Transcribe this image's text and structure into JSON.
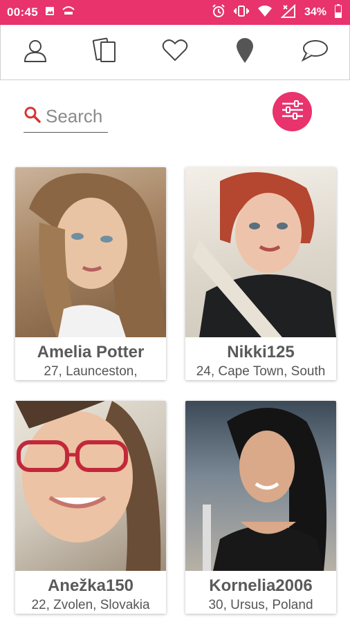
{
  "status_bar": {
    "time": "00:45",
    "battery": "34%",
    "color": "#e8336d"
  },
  "nav": {
    "items": [
      {
        "icon": "profile-icon"
      },
      {
        "icon": "cards-icon"
      },
      {
        "icon": "heart-icon"
      },
      {
        "icon": "location-pin-icon"
      },
      {
        "icon": "chat-bubble-icon"
      }
    ]
  },
  "search": {
    "placeholder": "Search",
    "value": ""
  },
  "filter": {
    "icon": "sliders-icon",
    "color": "#e8336d"
  },
  "profiles": [
    {
      "name": "Amelia Potter",
      "info": "27, Launceston,"
    },
    {
      "name": "Nikki125",
      "info": "24, Cape Town, South"
    },
    {
      "name": "Anežka150",
      "info": "22, Zvolen, Slovakia"
    },
    {
      "name": "Kornelia2006",
      "info": "30, Ursus, Poland"
    }
  ]
}
